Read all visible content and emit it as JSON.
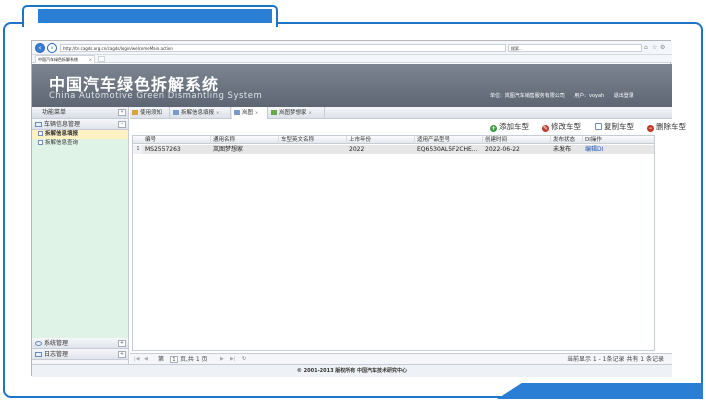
{
  "browser": {
    "url": "http://tn.cagds.org.cn/cagds/login/welcomeMain.action",
    "search_placeholder": "搜索...",
    "tab_title": "中国汽车绿色拆解系统",
    "window_controls": [
      "–",
      "▫",
      "×"
    ]
  },
  "header": {
    "title": "中国汽车绿色拆解系统",
    "subtitle": "China Automotive Green Dismantling System",
    "unit_label": "单位:",
    "unit_value": "岚图汽车销售服务有限公司",
    "user_label": "用户:",
    "user_value": "voyah",
    "logout": "退出登录"
  },
  "sidebar": {
    "title": "功能菜单",
    "groups": [
      {
        "label": "车辆信息管理"
      },
      {
        "label": "系统管理"
      },
      {
        "label": "日志管理"
      }
    ],
    "items": [
      {
        "label": "拆解信息填报"
      },
      {
        "label": "拆解信息查询"
      }
    ]
  },
  "tabs": [
    {
      "label": "使用须知"
    },
    {
      "label": "拆解信息填报"
    },
    {
      "label": "岚图"
    },
    {
      "label": "岚图梦想家"
    }
  ],
  "toolbar": {
    "add": "添加车型",
    "edit": "修改车型",
    "copy": "复制车型",
    "delete": "删除车型"
  },
  "grid": {
    "columns": [
      "编号",
      "通用名称",
      "车型英文名称",
      "上市年份",
      "适用产品型号",
      "创建时间",
      "发布状态",
      "DI操作"
    ],
    "rows": [
      {
        "num": "1",
        "id": "MS2557263",
        "name": "岚图梦想家",
        "en_name": "",
        "year": "2022",
        "model": "EQ6530AL5F2CHE...",
        "created": "2022-06-22",
        "status": "未发布",
        "action": "编辑DI"
      }
    ]
  },
  "pager": {
    "page_prefix": "第",
    "page_value": "1",
    "page_suffix": "页,共 1 页",
    "summary": "当前显示 1 - 1条记录  共有 1 条记录"
  },
  "footer": {
    "text": "© 2001-2013 版权所有  中国汽车技术研究中心"
  }
}
